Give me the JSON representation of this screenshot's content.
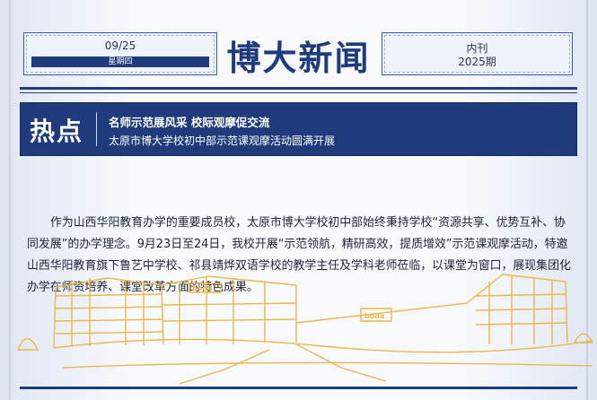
{
  "header": {
    "date": "09/25",
    "weekday": "星期四",
    "masthead": "博大新闻",
    "issue_label": "内刊",
    "issue_number": "2025期"
  },
  "hot": {
    "label": "热点",
    "title": "名师示范展风采 校际观摩促交流",
    "subtitle": "太原市博大学校初中部示范课观摩活动圆满开展"
  },
  "article": {
    "paragraph": "作为山西华阳教育办学的重要成员校，太原市博大学校初中部始终秉持学校“资源共享、优势互补、协同发展”的办学理念。9月23日至24日，我校开展“示范领航，精研高效，提质增效”示范课观摩活动，特邀山西华阳教育旗下鲁艺中学校、祁县靖烨双语学校的教学主任及学科老师莅临，以课堂为窗口，展现集团化办学在师资培养、课堂改革方面的特色成果。"
  },
  "illustration": {
    "sign_1": "boda",
    "sign_2": "boda"
  },
  "colors": {
    "primary": "#1f3b7c",
    "line_art": "#e8b84a"
  }
}
